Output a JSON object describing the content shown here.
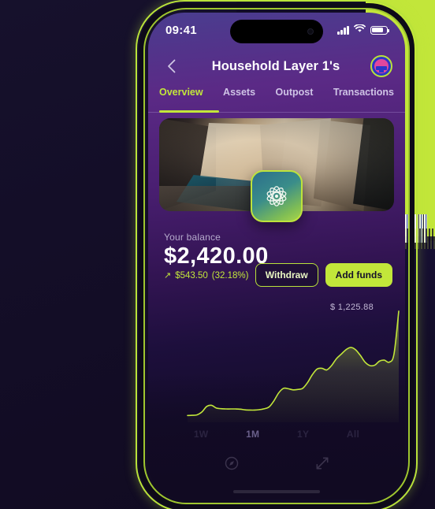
{
  "background": {
    "accent_green": "#c2e63a",
    "dark_navy": "#120c26"
  },
  "phone": {
    "statusbar": {
      "clock": "09:41",
      "signal_icon": "signal-bars-icon",
      "wifi_icon": "wifi-icon",
      "battery_icon": "battery-icon"
    },
    "navbar": {
      "back_icon": "chevron-left-icon",
      "title": "Household Layer 1's",
      "avatar_icon": "avatar"
    },
    "tabs": [
      {
        "label": "Overview",
        "active": true
      },
      {
        "label": "Assets",
        "active": false
      },
      {
        "label": "Outpost",
        "active": false
      },
      {
        "label": "Transactions",
        "active": false
      }
    ],
    "hero": {
      "alt": "architectural-interior-banner",
      "logo_icon": "flower-logo-icon"
    },
    "balance": {
      "label": "Your balance",
      "amount": "$2,420.00",
      "change_arrow": "↗",
      "change_value": "$543.50",
      "change_percent": "(32.18%)"
    },
    "actions": {
      "withdraw_label": "Withdraw",
      "add_funds_label": "Add funds"
    },
    "chart": {
      "value_label": "$ 1,225.88",
      "line_color": "#c2e63a"
    },
    "ranges": [
      {
        "label": "1W",
        "active": false
      },
      {
        "label": "1M",
        "active": true
      },
      {
        "label": "1Y",
        "active": false
      },
      {
        "label": "All",
        "active": false
      }
    ],
    "bottom_nav": [
      {
        "icon": "compass-icon"
      },
      {
        "icon": "expand-arrows-icon"
      }
    ]
  },
  "chart_data": {
    "type": "area",
    "title": "",
    "xlabel": "",
    "ylabel": "",
    "annotation": "$ 1,225.88",
    "grid": false,
    "legend": false,
    "line_color": "#c2e63a",
    "x": [
      0,
      1,
      2,
      3,
      4,
      5,
      6,
      7,
      8,
      9,
      10,
      11,
      12,
      13,
      14,
      15,
      16,
      17,
      18,
      19,
      20,
      21,
      22,
      23,
      24,
      25,
      26,
      27,
      28,
      29,
      30,
      31,
      32,
      33,
      34,
      35,
      36,
      37,
      38,
      39,
      40,
      41,
      42,
      43,
      44
    ],
    "values": [
      60,
      62,
      66,
      92,
      140,
      150,
      126,
      120,
      118,
      118,
      118,
      116,
      110,
      108,
      108,
      112,
      120,
      136,
      190,
      260,
      300,
      296,
      286,
      290,
      300,
      350,
      420,
      470,
      476,
      462,
      500,
      560,
      600,
      640,
      660,
      640,
      590,
      530,
      500,
      504,
      540,
      548,
      530,
      600,
      980
    ],
    "ylim": [
      0,
      1000
    ],
    "xlim": [
      0,
      44
    ]
  }
}
